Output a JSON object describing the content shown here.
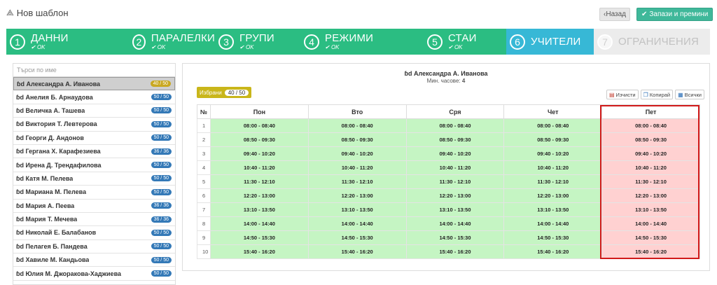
{
  "header": {
    "title": "Нов шаблон",
    "back_label": "Назад",
    "save_label": "Запази и премини"
  },
  "wizard": {
    "steps": [
      {
        "num": "1",
        "label": "ДАННИ",
        "status": "OK",
        "state": "done"
      },
      {
        "num": "2",
        "label": "ПАРАЛЕЛКИ",
        "status": "OK",
        "state": "done"
      },
      {
        "num": "3",
        "label": "ГРУПИ",
        "status": "OK",
        "state": "done"
      },
      {
        "num": "4",
        "label": "РЕЖИМИ",
        "status": "OK",
        "state": "done"
      },
      {
        "num": "5",
        "label": "СТАИ",
        "status": "OK",
        "state": "done"
      },
      {
        "num": "6",
        "label": "УЧИТЕЛИ",
        "status": "",
        "state": "active"
      },
      {
        "num": "7",
        "label": "ОГРАНИЧЕНИЯ",
        "status": "",
        "state": "future"
      }
    ]
  },
  "teachers": {
    "search_placeholder": "Търси по име",
    "items": [
      {
        "name": "Александра А. Иванова",
        "count": "40 / 50",
        "active": true
      },
      {
        "name": "Анелия Б. Арнаудова",
        "count": "50 / 50"
      },
      {
        "name": "Величка А. Ташева",
        "count": "50 / 50"
      },
      {
        "name": "Виктория Т. Левтерова",
        "count": "50 / 50"
      },
      {
        "name": "Георги Д. Андонов",
        "count": "50 / 50"
      },
      {
        "name": "Гергана Х. Карафезиева",
        "count": "36 / 36"
      },
      {
        "name": "Ирена Д. Трендафилова",
        "count": "50 / 50"
      },
      {
        "name": "Катя М. Пелева",
        "count": "50 / 50"
      },
      {
        "name": "Мариана М. Пелева",
        "count": "50 / 50"
      },
      {
        "name": "Мария А. Пеева",
        "count": "36 / 36"
      },
      {
        "name": "Мария Т. Мечева",
        "count": "36 / 36"
      },
      {
        "name": "Николай Е. Балабанов",
        "count": "50 / 50"
      },
      {
        "name": "Пелагея Б. Пандева",
        "count": "50 / 50"
      },
      {
        "name": "Хавиле М. Кандьова",
        "count": "50 / 50"
      },
      {
        "name": "Юлия М. Джоракова-Хаджиева",
        "count": "50 / 50"
      }
    ]
  },
  "schedule": {
    "teacher_name": "Александра А. Иванова",
    "min_hours_label": "Мин. часове:",
    "min_hours_value": "4",
    "selected_label": "Избрани",
    "selected_count": "40 / 50",
    "actions": {
      "clear": "Изчисти",
      "copy": "Копирай",
      "all": "Всички"
    },
    "col_index": "№",
    "days": [
      "Пон",
      "Вто",
      "Сря",
      "Чет",
      "Пет"
    ],
    "rows": [
      {
        "n": "1",
        "time": "08:00 - 08:40"
      },
      {
        "n": "2",
        "time": "08:50 - 09:30"
      },
      {
        "n": "3",
        "time": "09:40 - 10:20"
      },
      {
        "n": "4",
        "time": "10:40 - 11:20"
      },
      {
        "n": "5",
        "time": "11:30 - 12:10"
      },
      {
        "n": "6",
        "time": "12:20 - 13:00"
      },
      {
        "n": "7",
        "time": "13:10 - 13:50"
      },
      {
        "n": "8",
        "time": "14:00 - 14:40"
      },
      {
        "n": "9",
        "time": "14:50 - 15:30"
      },
      {
        "n": "10",
        "time": "15:40 - 16:20"
      }
    ],
    "unavailable_day_index": 4
  },
  "colors": {
    "done": "#2bbd82",
    "active": "#37b8d6",
    "free_cell": "#c5f5c3",
    "busy_cell": "#ffd1d1",
    "highlight_frame": "#d11a1a"
  }
}
